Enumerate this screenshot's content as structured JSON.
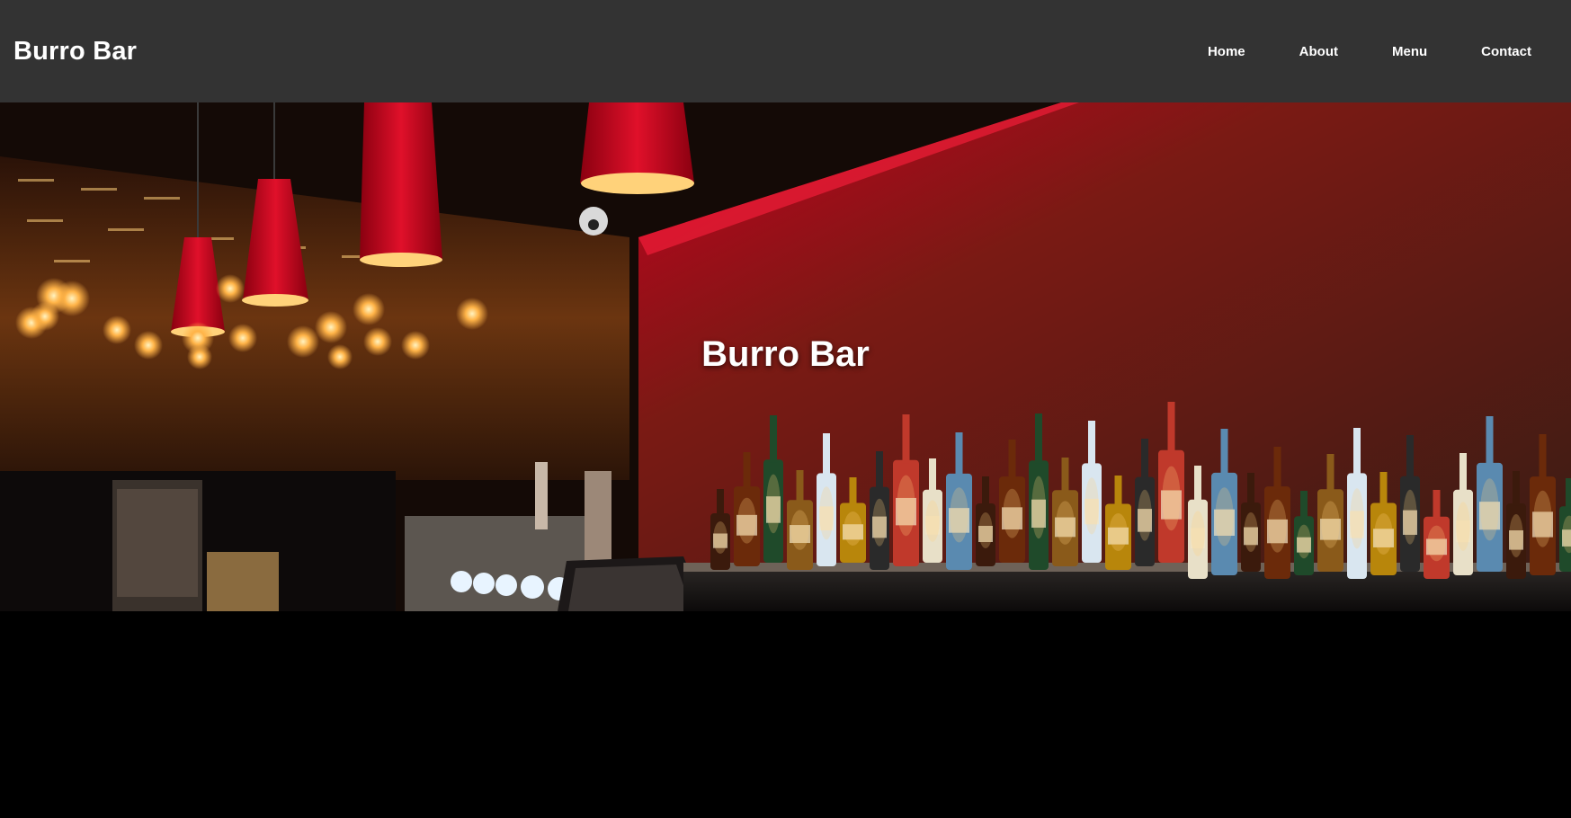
{
  "header": {
    "brand": "Burro Bar",
    "nav": [
      {
        "label": "Home"
      },
      {
        "label": "About"
      },
      {
        "label": "Menu"
      },
      {
        "label": "Contact"
      }
    ]
  },
  "hero": {
    "title": "Burro Bar",
    "image_subject": "bar interior with red pendant lamps, edison bulbs and backlit liquor bottle shelf"
  },
  "colors": {
    "header_bg": "#333333",
    "page_bg": "#000000",
    "text": "#ffffff",
    "accent_red": "#e0102a",
    "lamp_glow": "#ffb347"
  }
}
